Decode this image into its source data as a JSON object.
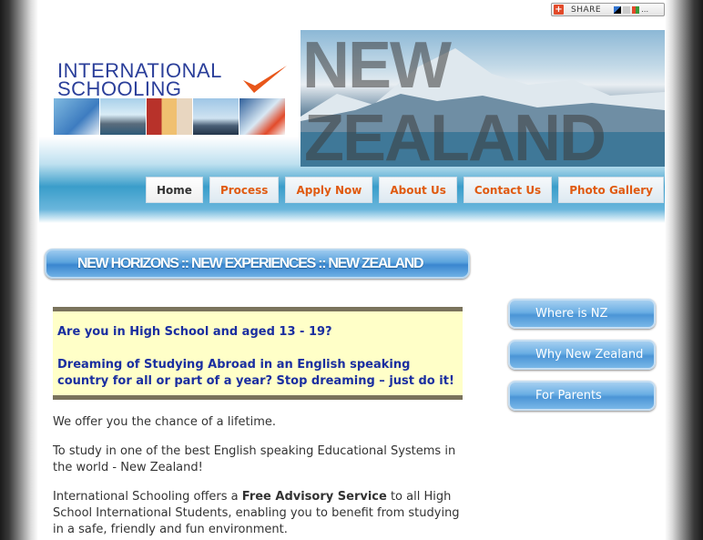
{
  "share": {
    "label": "SHARE"
  },
  "header": {
    "logo_line1": "INTERNATIONAL",
    "logo_line2": "SCHOOLING",
    "hero_word1": "NEW",
    "hero_word2": "ZEALAND"
  },
  "nav": {
    "items": [
      {
        "label": "Home",
        "active": true
      },
      {
        "label": "Process"
      },
      {
        "label": "Apply Now"
      },
      {
        "label": "About Us"
      },
      {
        "label": "Contact Us"
      },
      {
        "label": "Photo Gallery"
      }
    ]
  },
  "banner": {
    "text": "NEW HORIZONS :: NEW EXPERIENCES :: NEW ZEALAND"
  },
  "highlight": {
    "line1": "Are you in High School and aged 13 - 19?",
    "line2": "Dreaming of Studying Abroad in an English speaking country for all or part of a year? Stop dreaming – just do it!"
  },
  "content": {
    "p1": "We offer you the chance of a lifetime.",
    "p2": "To study in one of the best English speaking Educational Systems in the world - New Zealand!",
    "p3_before": "International Schooling offers a ",
    "p3_bold": "Free Advisory Service",
    "p3_after": " to all High School International Students, enabling you to benefit from studying in a safe, friendly and fun environment."
  },
  "sidebar": {
    "buttons": [
      {
        "label": "Where is NZ"
      },
      {
        "label": "Why New Zealand"
      },
      {
        "label": "For Parents"
      }
    ]
  },
  "colors": {
    "nav_text": "#e05a10",
    "highlight_text": "#1a2ea0",
    "highlight_bg": "#ffffc8",
    "logo_blue": "#2b3f9a"
  }
}
